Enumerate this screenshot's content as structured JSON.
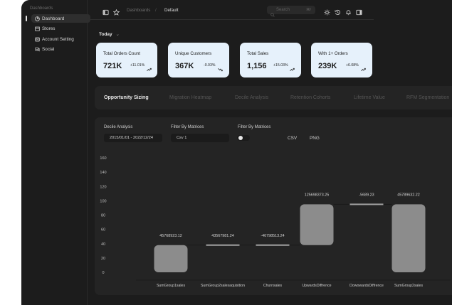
{
  "sidebar": {
    "title": "Dashboards",
    "items": [
      {
        "label": "Dashboard",
        "icon": "pie-chart-icon",
        "active": true
      },
      {
        "label": "Stores",
        "icon": "store-icon",
        "active": false
      },
      {
        "label": "Account Setting",
        "icon": "id-card-icon",
        "active": false
      },
      {
        "label": "Social",
        "icon": "chat-icon",
        "active": false
      }
    ]
  },
  "topbar": {
    "breadcrumb_root": "Dashboards",
    "breadcrumb_sep": "/",
    "breadcrumb_current": "Default",
    "search_placeholder": "Search",
    "search_shortcut": "⌘/"
  },
  "period": {
    "label": "Today",
    "caret": "⌄"
  },
  "kpis": [
    {
      "label": "Total Orders Count",
      "value": "721K",
      "delta": "+11.01%",
      "trend": "up"
    },
    {
      "label": "Unique Customers",
      "value": "367K",
      "delta": "-0.03%",
      "trend": "down"
    },
    {
      "label": "Total Sales",
      "value": "1,156",
      "delta": "+15.03%",
      "trend": "up"
    },
    {
      "label": "With 1+ Orders",
      "value": "239K",
      "delta": "+6.08%",
      "trend": "up"
    }
  ],
  "tabs": [
    "Opportunity Sizing",
    "Migration Heatmap",
    "Decile Analysis",
    "Retention Cohorts",
    "Lifetime Value",
    "RFM Segmentation"
  ],
  "active_tab": 0,
  "filters": {
    "decile_label": "Decile Analysis",
    "date_range": "2015/01/01 - 2022/12/24",
    "metrics_label": "Filter By Matrices",
    "metrics_value": "Csv 1",
    "toggle_label": "Filter By Matrices",
    "toggle_on": false,
    "export_csv": "CSV",
    "export_png": "PNG"
  },
  "colors": {
    "accent_card": "#e6f1fb",
    "bar": "#8c8c8c",
    "panel": "#242424",
    "background": "#1c1c1c"
  },
  "chart_data": {
    "type": "bar",
    "subtype": "waterfall",
    "categories": [
      "SumGroup1sales",
      "SumGroup2salesaquisition",
      "Churnsales",
      "UpwardsDiffrence",
      "DowowardsDiffrence",
      "SumGroup2sales"
    ],
    "labels": [
      "45768923.12",
      "43567981.24",
      "-46798513.24",
      "125698373.25",
      "-5689.23",
      "45789632.22"
    ],
    "bars": [
      {
        "start": 0,
        "end": 38
      },
      {
        "start": 38,
        "end": 38
      },
      {
        "start": 38,
        "end": 38
      },
      {
        "start": 38,
        "end": 95
      },
      {
        "start": 95,
        "end": 95
      },
      {
        "start": 0,
        "end": 95
      }
    ],
    "yticks": [
      0,
      20,
      40,
      60,
      80,
      100,
      120,
      140,
      160
    ],
    "ylim": [
      0,
      160
    ]
  }
}
